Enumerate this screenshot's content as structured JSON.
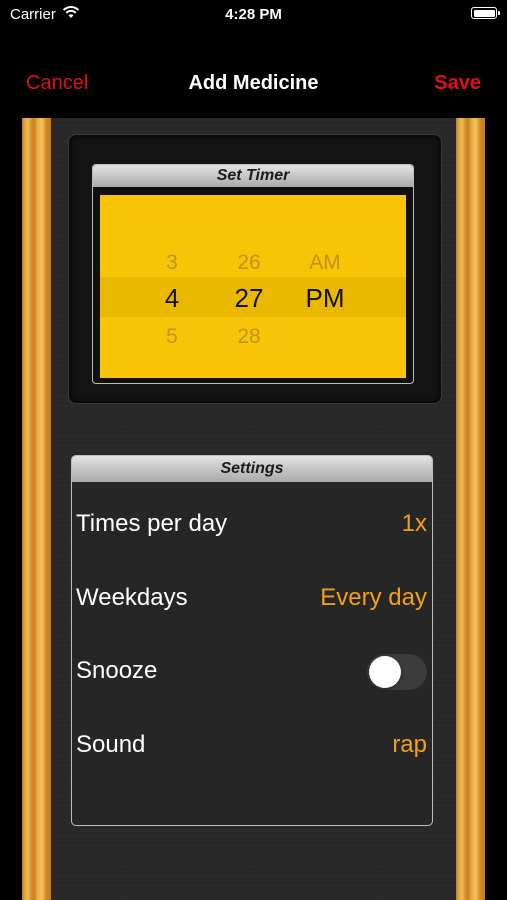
{
  "status_bar": {
    "carrier": "Carrier",
    "time": "4:28 PM"
  },
  "nav": {
    "cancel": "Cancel",
    "title": "Add Medicine",
    "save": "Save"
  },
  "timer": {
    "header": "Set Timer",
    "hour": {
      "above": "3",
      "selected": "4",
      "below": "5"
    },
    "minute": {
      "above": "26",
      "selected": "27",
      "below": "28"
    },
    "period": {
      "above": "AM",
      "selected": "PM"
    }
  },
  "settings": {
    "header": "Settings",
    "rows": [
      {
        "label": "Times per day",
        "value": "1x"
      },
      {
        "label": "Weekdays",
        "value": "Every day"
      },
      {
        "label": "Snooze",
        "toggle_on": false
      },
      {
        "label": "Sound",
        "value": "rap"
      }
    ]
  },
  "colors": {
    "accent_red": "#e0101a",
    "value_orange": "#f2a019",
    "lcd_yellow": "#f7c506",
    "wood": "#e3a73e"
  }
}
